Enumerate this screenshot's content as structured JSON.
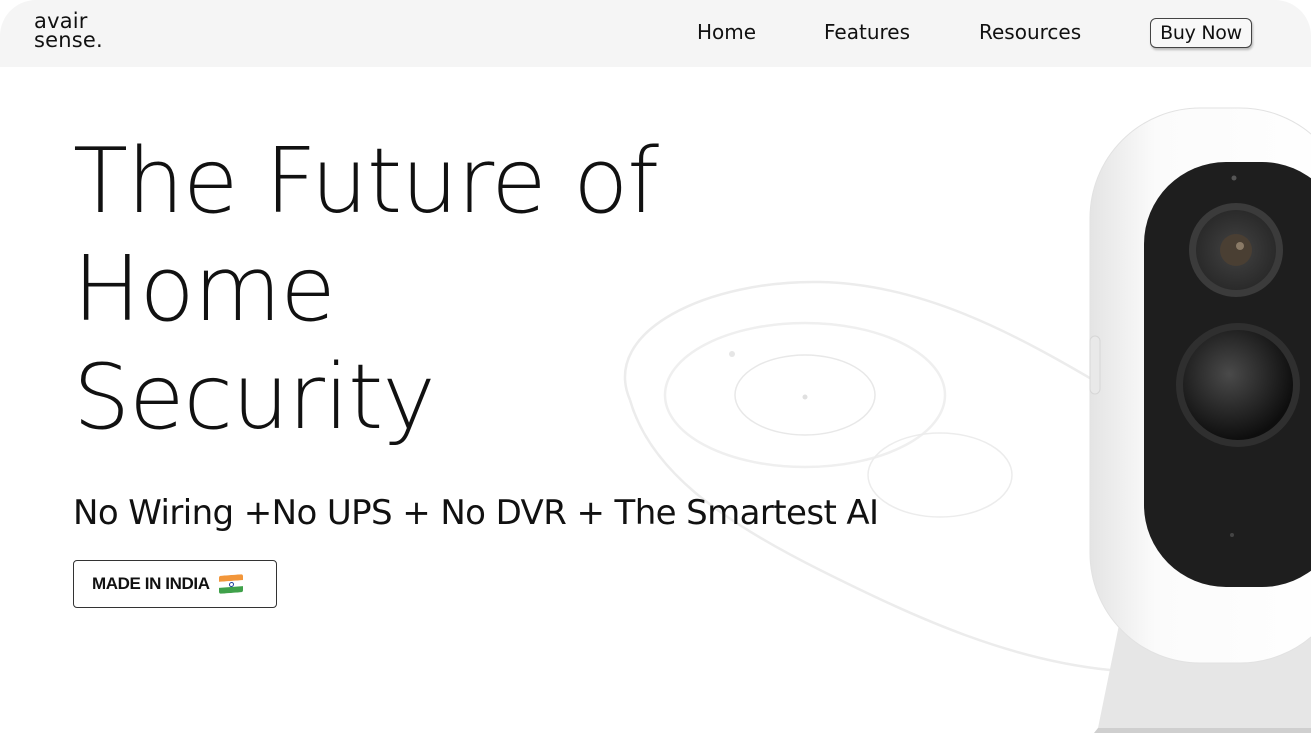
{
  "header": {
    "logo_line1": "avair",
    "logo_line2": "sense.",
    "nav": {
      "home": "Home",
      "features": "Features",
      "resources": "Resources"
    },
    "buy_label": "Buy Now"
  },
  "hero": {
    "title_line1": "The Future of",
    "title_line2": "Home",
    "title_line3": "Security",
    "subtitle": "No Wiring +No UPS + No DVR + The Smartest AI",
    "badge_label": "MADE IN INDIA",
    "badge_icon": "india-flag-icon"
  },
  "colors": {
    "header_bg": "#f5f5f5",
    "text": "#111111",
    "camera_body": "#f2f2f2",
    "camera_face": "#1e1e1e"
  }
}
